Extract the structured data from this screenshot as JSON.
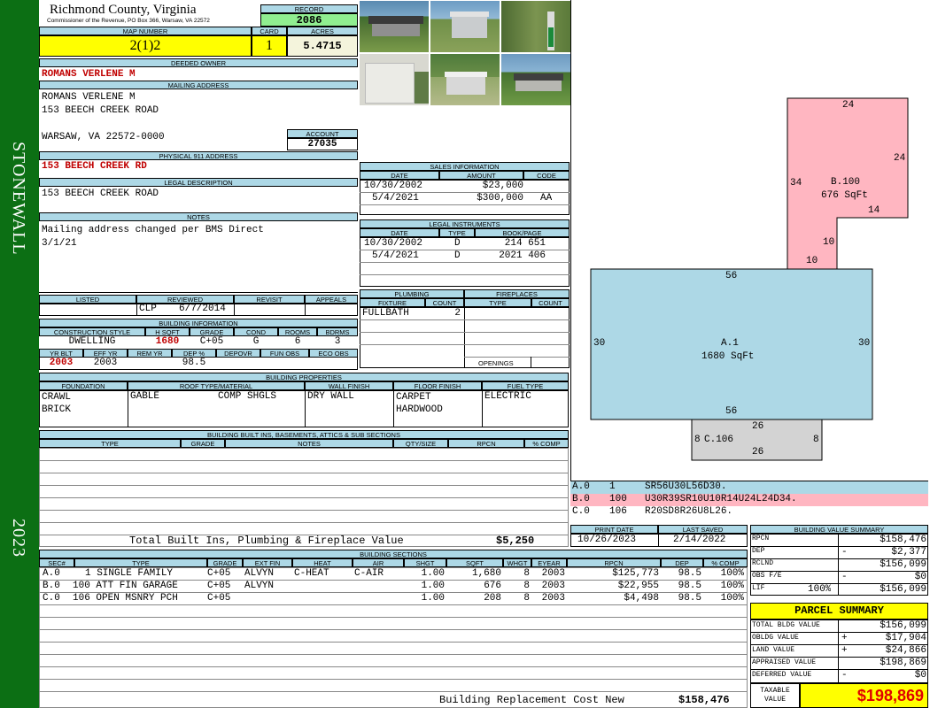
{
  "sidebar": {
    "district": "STONEWALL",
    "year": "2023"
  },
  "header": {
    "county": "Richmond County, Virginia",
    "commissioner": "Commissioner of the Revenue, PO Box 366, Warsaw, VA 22572",
    "record_label": "RECORD",
    "record": "2086",
    "map_label": "MAP NUMBER",
    "map": "2(1)2",
    "card_label": "CARD",
    "card": "1",
    "acres_label": "ACRES",
    "acres": "5.4715"
  },
  "owner": {
    "deeded_label": "DEEDED OWNER",
    "deeded": "ROMANS VERLENE M",
    "mailing_label": "MAILING ADDRESS",
    "mailing": [
      "ROMANS VERLENE M",
      "153 BEECH CREEK ROAD",
      "",
      "WARSAW, VA 22572-0000"
    ],
    "account_label": "ACCOUNT",
    "account": "27035",
    "physical_label": "PHYSICAL 911 ADDRESS",
    "physical": "153 BEECH CREEK RD",
    "legal_label": "LEGAL DESCRIPTION",
    "legal": "153 BEECH CREEK ROAD",
    "notes_label": "NOTES",
    "notes": [
      "Mailing address changed per BMS Direct",
      "3/1/21"
    ]
  },
  "review": {
    "labels": [
      "LISTED",
      "REVIEWED",
      "REVISIT",
      "APPEALS"
    ],
    "reviewed_by": "CLP",
    "reviewed_date": "6/7/2014"
  },
  "building_info": {
    "title": "BUILDING INFORMATION",
    "labels": [
      "CONSTRUCTION STYLE",
      "H SQFT",
      "GRADE",
      "COND",
      "ROOMS",
      "BDRMS"
    ],
    "values": [
      "DWELLING",
      "1680",
      "C+05",
      "G",
      "6",
      "3"
    ],
    "labels2": [
      "YR BLT",
      "EFF YR",
      "REM YR",
      "DEP %",
      "DEPOVR",
      "FUN OBS",
      "ECO OBS"
    ],
    "values2": [
      "2003",
      "2003",
      "",
      "98.5",
      "",
      "",
      ""
    ]
  },
  "sales": {
    "title": "SALES INFORMATION",
    "cols": [
      "DATE",
      "AMOUNT",
      "CODE"
    ],
    "rows": [
      [
        "10/30/2002",
        "$23,000",
        ""
      ],
      [
        "5/4/2021",
        "$300,000",
        "AA"
      ]
    ]
  },
  "legal_instruments": {
    "title": "LEGAL INSTRUMENTS",
    "cols": [
      "DATE",
      "TYPE",
      "BOOK/PAGE"
    ],
    "rows": [
      [
        "10/30/2002",
        "D",
        "214 651"
      ],
      [
        "5/4/2021",
        "D",
        "2021 406"
      ]
    ]
  },
  "plumbing": {
    "title": "PLUMBING",
    "cols": [
      "FIXTURE",
      "COUNT"
    ],
    "rows": [
      [
        "FULLBATH",
        "2"
      ]
    ]
  },
  "fireplaces": {
    "title": "FIREPLACES",
    "cols": [
      "TYPE",
      "COUNT"
    ],
    "openings": "OPENINGS"
  },
  "properties": {
    "title": "BUILDING PROPERTIES",
    "cols": [
      "FOUNDATION",
      "ROOF TYPE/MATERIAL",
      "WALL FINISH",
      "FLOOR FINISH",
      "FUEL TYPE"
    ],
    "foundation": [
      "CRAWL",
      "BRICK"
    ],
    "roof_type": "GABLE",
    "roof_material": "COMP SHGLS",
    "wall": "DRY WALL",
    "floor": [
      "CARPET",
      "HARDWOOD"
    ],
    "fuel": "ELECTRIC"
  },
  "builtins": {
    "title": "BUILDING BUILT INS, BASEMENTS, ATTICS & SUB SECTIONS",
    "cols": [
      "TYPE",
      "GRADE",
      "NOTES",
      "QTY/SIZE",
      "RPCN",
      "% COMP"
    ],
    "total_label": "Total Built Ins, Plumbing & Fireplace Value",
    "total": "$5,250"
  },
  "print": {
    "print_label": "PRINT DATE",
    "print_date": "10/26/2023",
    "saved_label": "LAST SAVED",
    "saved_date": "2/14/2022"
  },
  "sections": {
    "title": "BUILDING SECTIONS",
    "cols": [
      "SEC#",
      "TYPE",
      "GRADE",
      "EXT FIN",
      "HEAT",
      "AIR",
      "SHGT",
      "SQFT",
      "WHGT",
      "EYEAR",
      "RPCN",
      "DEP",
      "% COMP"
    ],
    "rows": [
      [
        "A.0",
        "1 SINGLE FAMILY",
        "C+05",
        "ALVYN",
        "C-HEAT",
        "C-AIR",
        "1.00",
        "1,680",
        "8",
        "2003",
        "$125,773",
        "98.5",
        "100%"
      ],
      [
        "B.0",
        "100 ATT FIN GARAGE",
        "C+05",
        "ALVYN",
        "",
        "",
        "1.00",
        "676",
        "8",
        "2003",
        "$22,955",
        "98.5",
        "100%"
      ],
      [
        "C.0",
        "106 OPEN MSNRY PCH",
        "C+05",
        "",
        "",
        "",
        "1.00",
        "208",
        "8",
        "2003",
        "$4,498",
        "98.5",
        "100%"
      ]
    ],
    "replacement_label": "Building Replacement Cost New",
    "replacement": "$158,476"
  },
  "sketch": {
    "b_label": "B.100",
    "b_area": "676 SqFt",
    "b_dims": [
      "24",
      "24",
      "34",
      "14",
      "10",
      "10"
    ],
    "a_label": "A.1",
    "a_area": "1680 SqFt",
    "a_dims": [
      "56",
      "30",
      "30",
      "56"
    ],
    "c_label": "C.106",
    "c_dims": [
      "26",
      "8",
      "8",
      "26"
    ],
    "legend": [
      {
        "sec": "A.0",
        "code": "1",
        "path": "SR56U30L56D30.",
        "color": "#add8e6"
      },
      {
        "sec": "B.0",
        "code": "100",
        "path": "U30R39SR10U10R14U24L24D34.",
        "color": "#ffb6c1"
      },
      {
        "sec": "C.0",
        "code": "106",
        "path": "R20SD8R26U8L26.",
        "color": "#ffffff"
      }
    ]
  },
  "value_summary": {
    "title": "BUILDING VALUE SUMMARY",
    "rows": [
      {
        "label": "RPCN",
        "sign": "",
        "value": "$158,476"
      },
      {
        "label": "DEP",
        "sign": "-",
        "value": "$2,377"
      },
      {
        "label": "RCLND",
        "sign": "",
        "value": "$156,099"
      },
      {
        "label": "OBS F/E",
        "sign": "-",
        "value": "$0"
      },
      {
        "label": "LIF",
        "pct": "100%",
        "sign": "",
        "value": "$156,099"
      }
    ]
  },
  "parcel": {
    "title": "PARCEL SUMMARY",
    "rows": [
      {
        "label": "TOTAL BLDG VALUE",
        "sign": "",
        "value": "$156,099"
      },
      {
        "label": "OBLDG VALUE",
        "sign": "+",
        "value": "$17,904"
      },
      {
        "label": "LAND VALUE",
        "sign": "+",
        "value": "$24,866"
      },
      {
        "label": "APPRAISED VALUE",
        "sign": "",
        "value": "$198,869"
      },
      {
        "label": "DEFERRED VALUE",
        "sign": "-",
        "value": "$0"
      }
    ],
    "taxable_label": "TAXABLE VALUE",
    "taxable": "$198,869"
  }
}
